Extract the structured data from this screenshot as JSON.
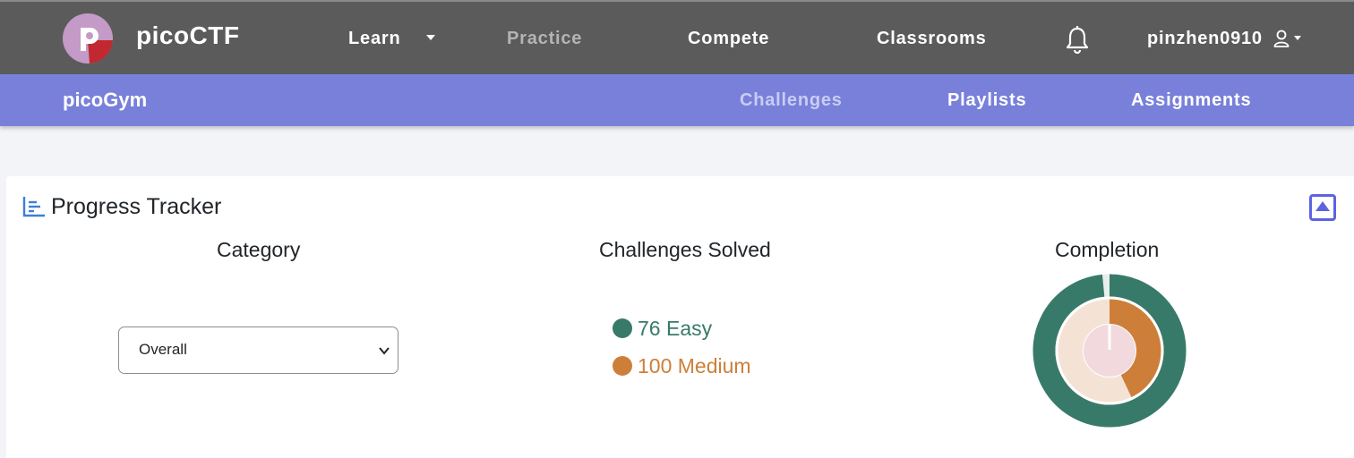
{
  "brand": {
    "name": "picoCTF"
  },
  "nav": {
    "learn": "Learn",
    "practice": "Practice",
    "compete": "Compete",
    "classrooms": "Classrooms",
    "username": "pinzhen0910"
  },
  "subnav": {
    "brand": "picoGym",
    "challenges": "Challenges",
    "playlists": "Playlists",
    "assignments": "Assignments"
  },
  "tracker": {
    "title": "Progress Tracker",
    "category_heading": "Category",
    "solved_heading": "Challenges Solved",
    "completion_heading": "Completion",
    "category_selected": "Overall",
    "easy": {
      "label": "76 Easy",
      "count": 76,
      "color": "#387a6a"
    },
    "medium": {
      "label": "100 Medium",
      "count": 100,
      "color": "#cd7f3a"
    },
    "completion": {
      "easy_fraction": 0.985,
      "medium_fraction": 0.43,
      "easy_track_color": "#e8eeeb",
      "medium_track_color": "#f4e3d5",
      "center_color": "#f1d9de"
    }
  },
  "icons": {
    "bell": "bell-icon",
    "user": "user-icon",
    "chart": "bar-chart-icon",
    "collapse": "caret-up-icon"
  }
}
